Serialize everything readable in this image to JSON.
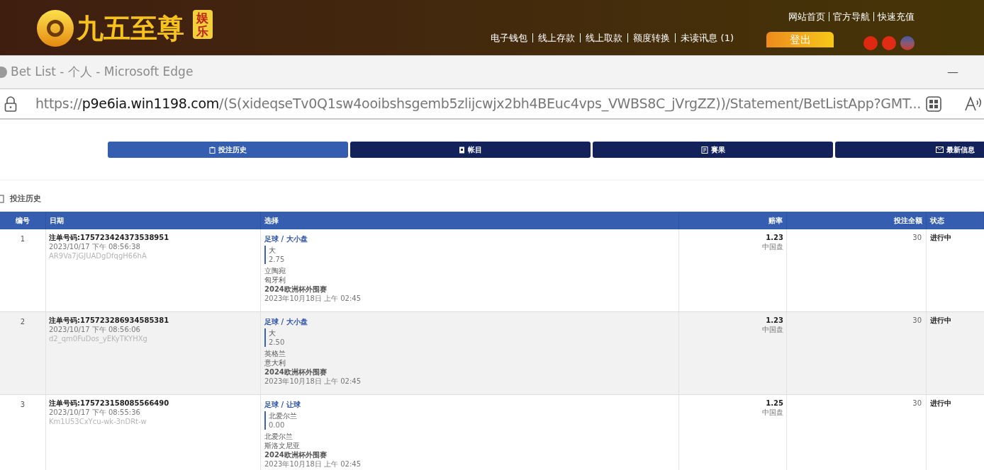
{
  "site_header": {
    "logo_text": "九五至尊",
    "logo_badge": "娱乐",
    "top_links": [
      "网站首页",
      "官方导航",
      "快速充值"
    ],
    "nav_links": [
      "电子钱包",
      "线上存款",
      "线上取款",
      "额度转换",
      "未读讯息 (1)"
    ],
    "logout_button": "登出"
  },
  "window": {
    "title": "Bet List - 个人 - Microsoft Edge",
    "minimize": "—"
  },
  "address_bar": {
    "scheme": "https://",
    "host": "p9e6ia.win1198.com",
    "path": "/(S(xideqseTv0Q1sw4ooibshsgemb5zlijcwjx2bh4BEuc4vps_VWBS8C_jVrgZZ))/Statement/BetListApp?GMT..."
  },
  "tabs": [
    {
      "label": "投注历史",
      "selected": true
    },
    {
      "label": "帐目",
      "selected": false
    },
    {
      "label": "賽果",
      "selected": false
    },
    {
      "label": "最新信息",
      "selected": false
    }
  ],
  "section_title": "投注历史",
  "table": {
    "columns": [
      "编号",
      "日期",
      "选择",
      "赔率",
      "投注全额",
      "状态"
    ],
    "rows": [
      {
        "no": "1",
        "ticket": "注单号码:175723424373538951",
        "datetime": "2023/10/17 下午 08:56:38",
        "ref": "AR9Va7jGJUADgDfqgH66hA",
        "market": "足球 / 大小盘",
        "pick": "大",
        "line": "2.75",
        "home": "立陶宛",
        "away": "匈牙利",
        "league": "2024欧洲杯外围赛",
        "match_time": "2023年10月18日 上午 02:45",
        "odds": "1.23",
        "odds_type": "中国盘",
        "stake": "30",
        "status": "进行中"
      },
      {
        "no": "2",
        "ticket": "注单号码:175723286934585381",
        "datetime": "2023/10/17 下午 08:56:06",
        "ref": "d2_qm0FuDos_yEKyTKYHXg",
        "market": "足球 / 大小盘",
        "pick": "大",
        "line": "2.50",
        "home": "英格兰",
        "away": "意大利",
        "league": "2024欧洲杯外围赛",
        "match_time": "2023年10月18日 上午 02:45",
        "odds": "1.23",
        "odds_type": "中国盘",
        "stake": "30",
        "status": "进行中"
      },
      {
        "no": "3",
        "ticket": "注单号码:175723158085566490",
        "datetime": "2023/10/17 下午 08:55:36",
        "ref": "Km1U53CxYcu-wk-3nDRt-w",
        "market": "足球 / 让球",
        "pick": "北爱尔兰",
        "line": "0.00",
        "home": "北爱尔兰",
        "away": "斯洛文尼亚",
        "league": "2024欧洲杯外围赛",
        "match_time": "2023年10月18日 上午 02:45",
        "odds": "1.25",
        "odds_type": "中国盘",
        "stake": "30",
        "status": "进行中"
      }
    ]
  }
}
